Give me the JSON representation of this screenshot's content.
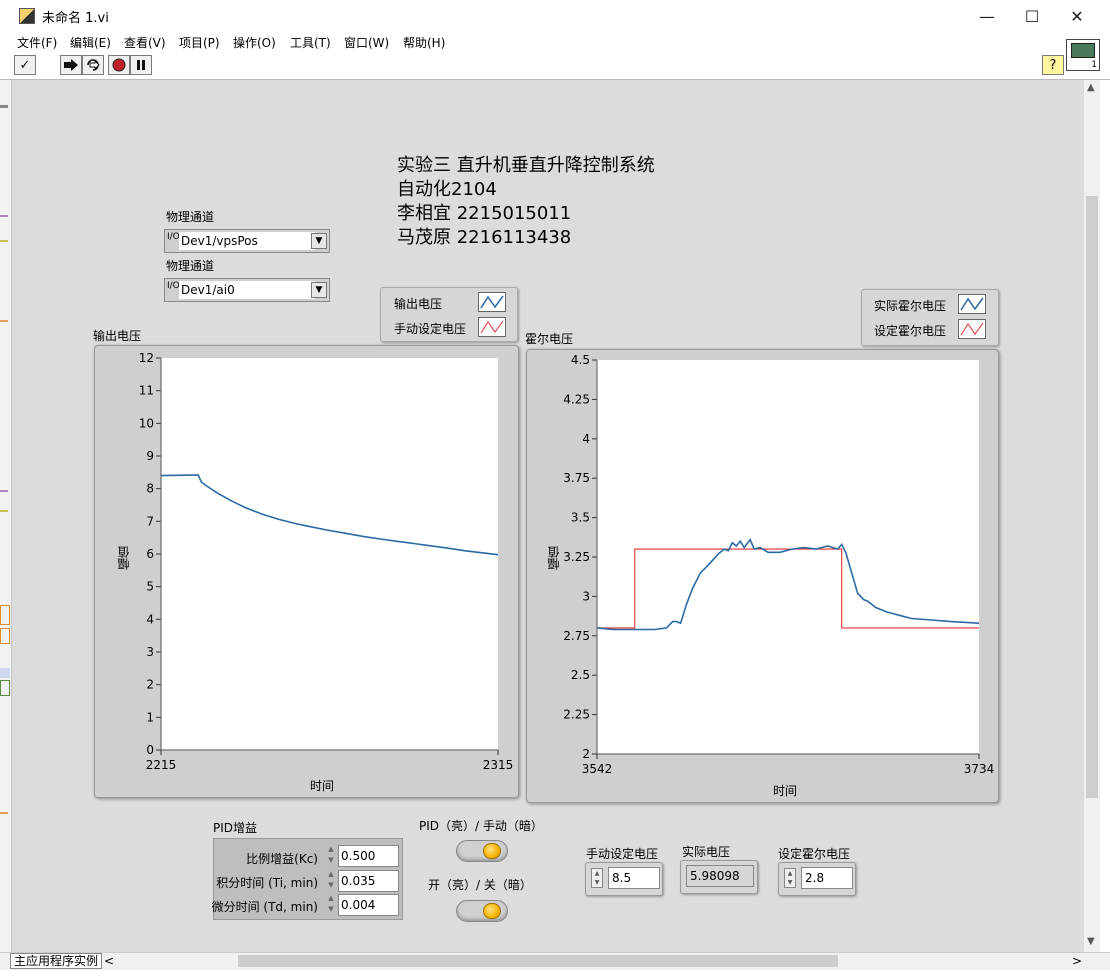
{
  "window": {
    "title": "未命名 1.vi",
    "min_glyph": "—",
    "max_glyph": "☐",
    "close_glyph": "✕"
  },
  "menu": [
    "文件(F)",
    "编辑(E)",
    "查看(V)",
    "项目(P)",
    "操作(O)",
    "工具(T)",
    "窗口(W)",
    "帮助(H)"
  ],
  "toolbar": {
    "run_glyph": "✓",
    "run_icon": "check-icon",
    "continuous_icon": "continuous-run-icon",
    "abort_icon": "abort-icon",
    "pause_icon": "pause-icon",
    "help_glyph": "?",
    "vi_icon_number": "1"
  },
  "header": {
    "line1": "实验三 直升机垂直升降控制系统",
    "line2": "自动化2104",
    "line3": "李相宜 2215015011",
    "line4": "马茂原 2216113438"
  },
  "channels": [
    {
      "label": "物理通道",
      "value": "Dev1/vpsPos",
      "io_glyph": "I/O"
    },
    {
      "label": "物理通道",
      "value": "Dev1/ai0",
      "io_glyph": "I/O"
    }
  ],
  "legend_left": {
    "series1": "输出电压",
    "series2": "手动设定电压"
  },
  "legend_right": {
    "series1": "实际霍尔电压",
    "series2": "设定霍尔电压"
  },
  "colors": {
    "series_actual": "#2a6aa4",
    "series_setpoint": "#e03030",
    "panel_bg": "#dcdcdc",
    "led_on": "#f5b400"
  },
  "chart_data": [
    {
      "type": "line",
      "title": "输出电压",
      "xlabel": "时间",
      "ylabel": "幅值",
      "xlim": [
        2215,
        2315
      ],
      "ylim": [
        0,
        12
      ],
      "x_ticks": [
        "2215",
        "2315"
      ],
      "y_ticks": [
        "12",
        "11",
        "10",
        "9",
        "8",
        "7",
        "6",
        "5",
        "4",
        "3",
        "2",
        "1",
        "0"
      ],
      "series": [
        {
          "name": "输出电压",
          "x": [
            2215,
            2220,
            2226,
            2227,
            2229,
            2232,
            2236,
            2240,
            2245,
            2250,
            2255,
            2260,
            2265,
            2270,
            2275,
            2280,
            2285,
            2290,
            2295,
            2300,
            2305,
            2310,
            2315
          ],
          "y": [
            8.4,
            8.41,
            8.42,
            8.2,
            8.05,
            7.85,
            7.62,
            7.42,
            7.22,
            7.06,
            6.93,
            6.82,
            6.72,
            6.63,
            6.54,
            6.46,
            6.39,
            6.32,
            6.25,
            6.18,
            6.1,
            6.04,
            5.98
          ]
        },
        {
          "name": "手动设定电压",
          "x": [],
          "y": []
        }
      ]
    },
    {
      "type": "line",
      "title": "霍尔电压",
      "xlabel": "时间",
      "ylabel": "幅值",
      "xlim": [
        3542,
        3734
      ],
      "ylim": [
        2,
        4.5
      ],
      "x_ticks": [
        "3542",
        "3734"
      ],
      "y_ticks": [
        "4.5",
        "4.25",
        "4",
        "3.75",
        "3.5",
        "3.25",
        "3",
        "2.75",
        "2.5",
        "2.25",
        "2"
      ],
      "series": [
        {
          "name": "实际霍尔电压",
          "x": [
            3542,
            3550,
            3560,
            3571,
            3577,
            3580,
            3582,
            3584,
            3587,
            3590,
            3594,
            3598,
            3603,
            3606,
            3608,
            3610,
            3612,
            3614,
            3616,
            3619,
            3621,
            3624,
            3628,
            3634,
            3640,
            3646,
            3652,
            3658,
            3663,
            3665,
            3667,
            3670,
            3673,
            3676,
            3678,
            3682,
            3688,
            3694,
            3700,
            3710,
            3720,
            3734
          ],
          "y": [
            2.8,
            2.79,
            2.79,
            2.79,
            2.8,
            2.84,
            2.84,
            2.83,
            2.95,
            3.05,
            3.15,
            3.2,
            3.27,
            3.3,
            3.29,
            3.34,
            3.32,
            3.35,
            3.31,
            3.36,
            3.3,
            3.31,
            3.28,
            3.28,
            3.3,
            3.31,
            3.3,
            3.32,
            3.3,
            3.33,
            3.28,
            3.15,
            3.02,
            2.98,
            2.97,
            2.93,
            2.9,
            2.88,
            2.86,
            2.85,
            2.84,
            2.83
          ]
        },
        {
          "name": "设定霍尔电压",
          "x": [
            3542,
            3561,
            3561,
            3646,
            3646,
            3665,
            3665,
            3734
          ],
          "y": [
            2.8,
            2.8,
            3.3,
            3.3,
            3.3,
            3.3,
            2.8,
            2.8
          ]
        }
      ]
    }
  ],
  "pid": {
    "title": "PID增益",
    "kc_label": "比例增益(Kc)",
    "kc_value": "0.500",
    "ti_label": "积分时间 (Ti, min)",
    "ti_value": "0.035",
    "td_label": "微分时间 (Td, min)",
    "td_value": "0.004"
  },
  "switches": {
    "pid_manual_label": "PID（亮）/ 手动（暗）",
    "on_off_label": "开（亮）/ 关（暗）"
  },
  "numerics": {
    "manual_voltage_label": "手动设定电压",
    "manual_voltage_value": "8.5",
    "actual_voltage_label": "实际电压",
    "actual_voltage_value": "5.98098",
    "hall_setpoint_label": "设定霍尔电压",
    "hall_setpoint_value": "2.8"
  },
  "statusbar": {
    "tab_label": "主应用程序实例",
    "left_arrow": "<",
    "right_arrow": ">"
  }
}
